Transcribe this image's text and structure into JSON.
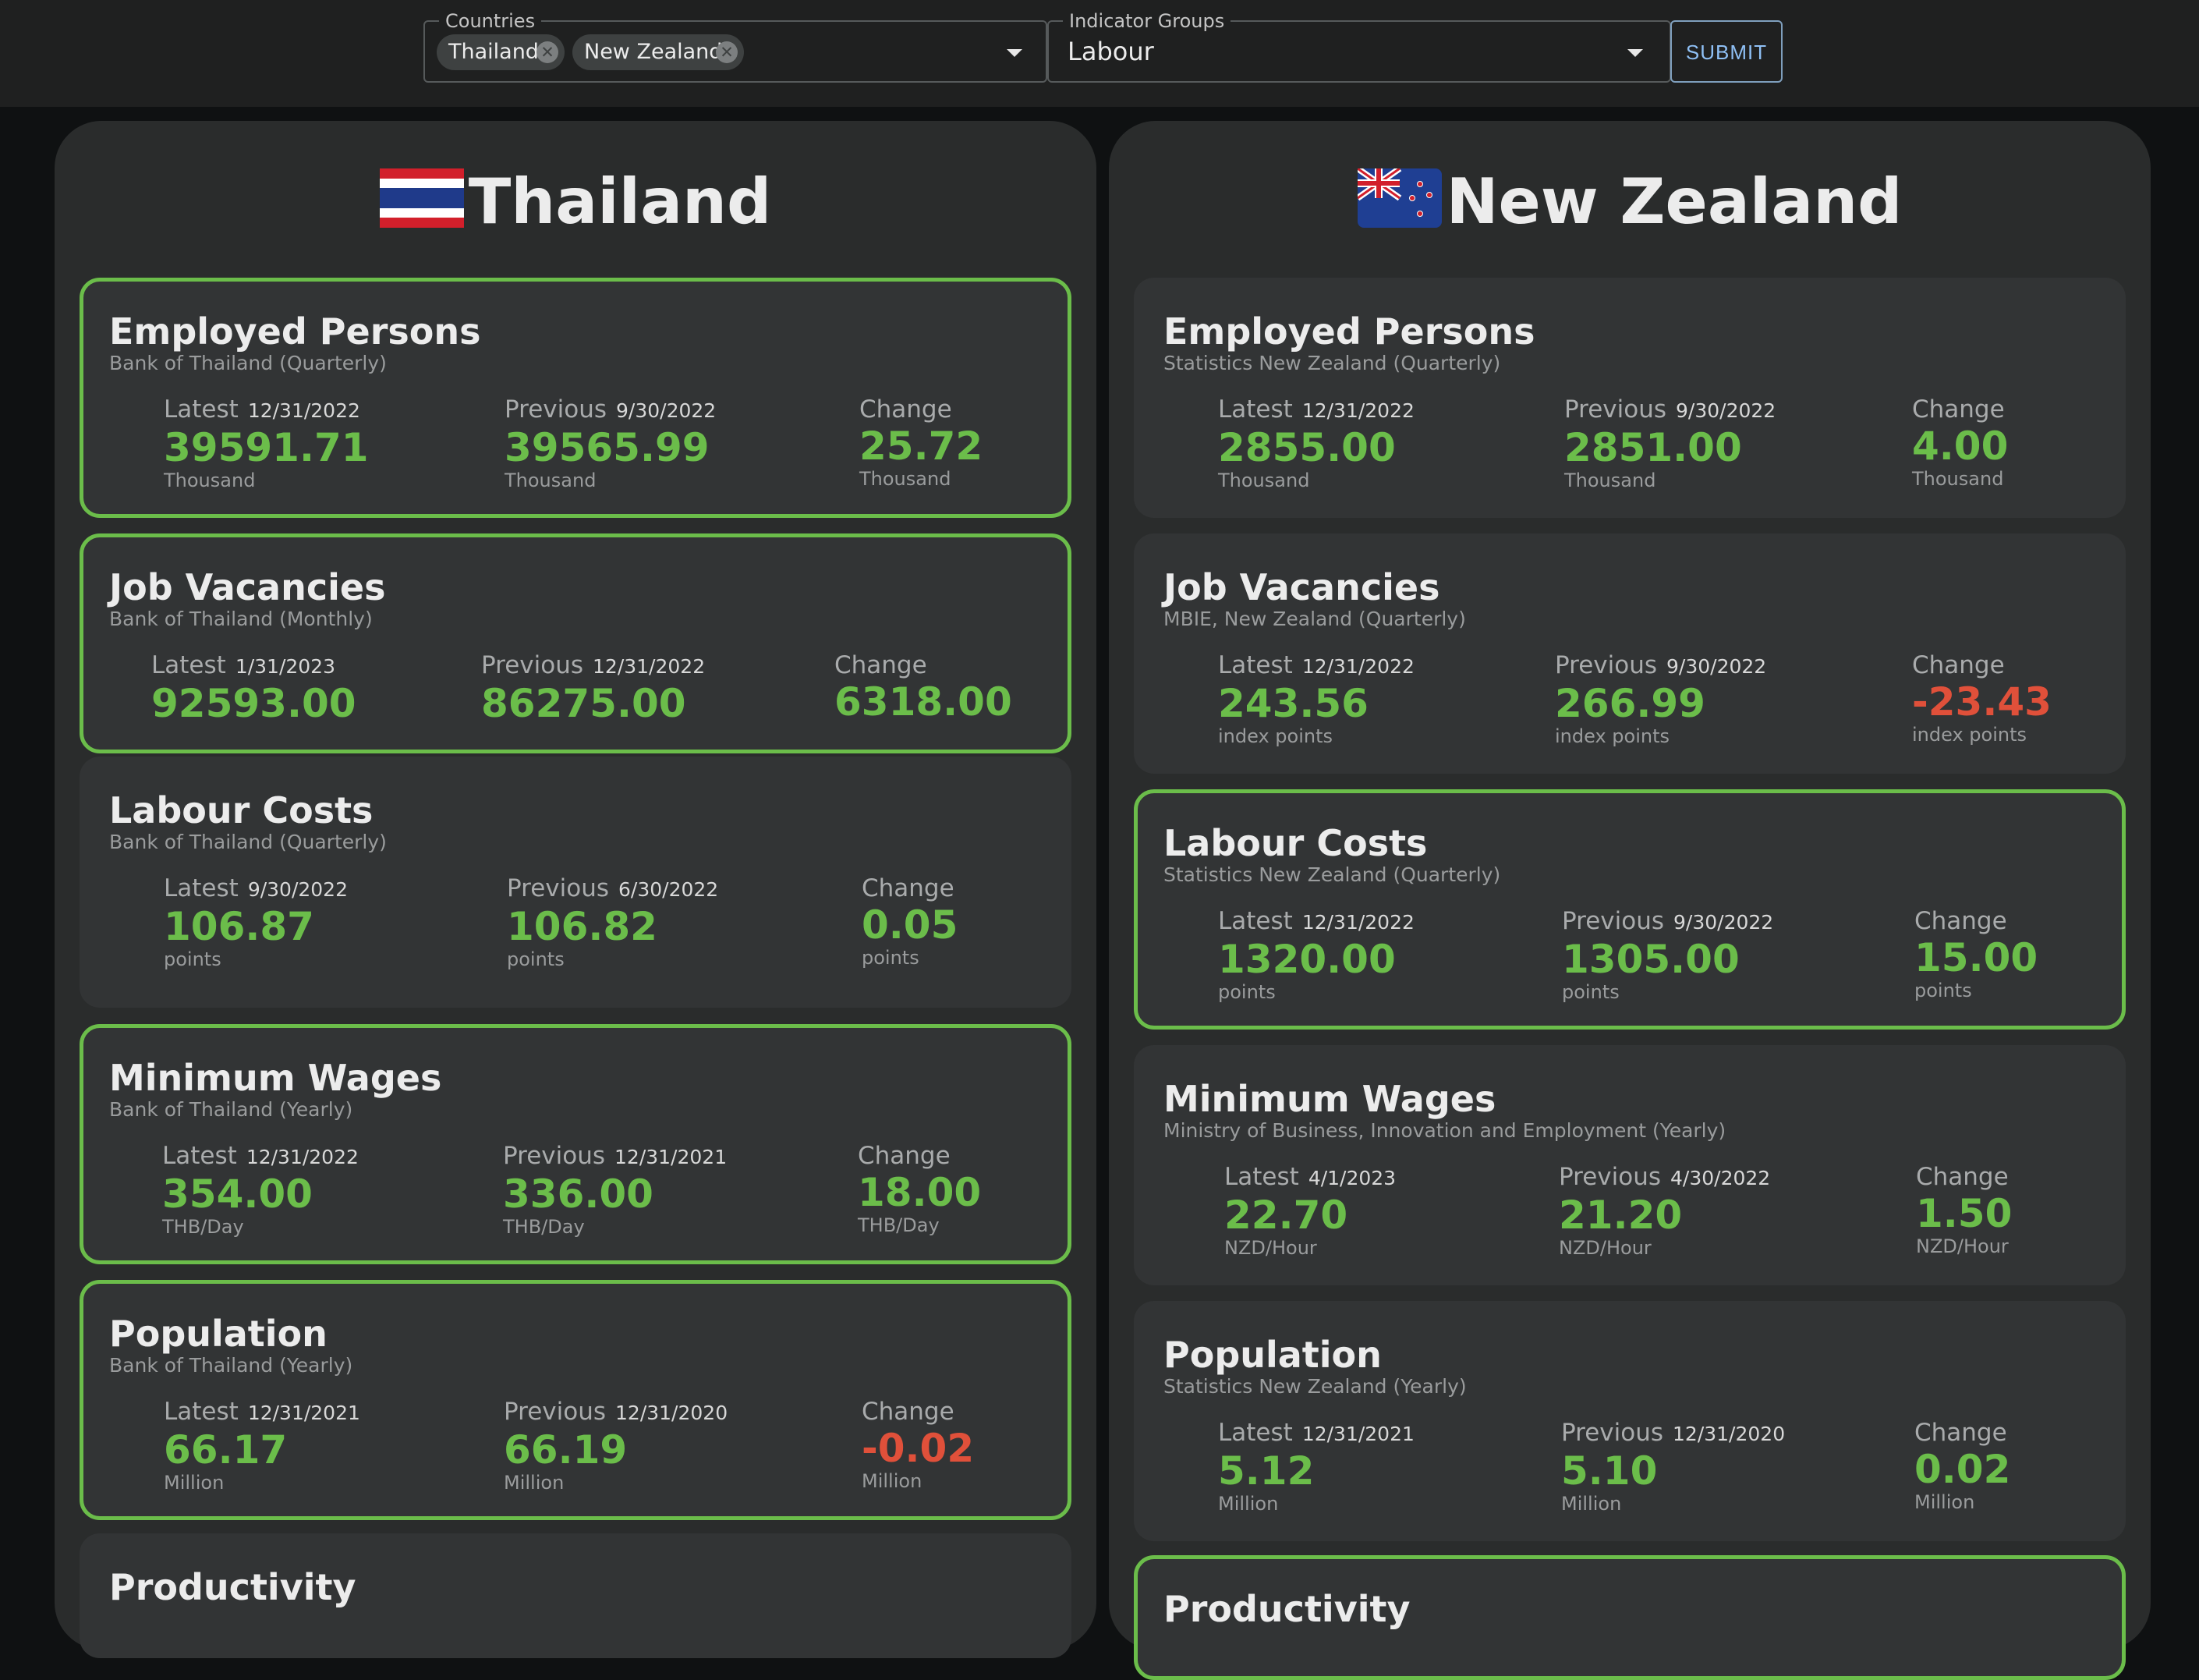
{
  "filters": {
    "countries_label": "Countries",
    "countries": [
      "Thailand",
      "New Zealand"
    ],
    "indicator_groups_label": "Indicator Groups",
    "indicator_group_value": "Labour",
    "submit_label": "SUBMIT"
  },
  "colors": {
    "positive": "#6bbd4a",
    "negative": "#e0503a",
    "highlight_border": "#6bbd4a"
  },
  "panels": [
    {
      "country": "Thailand",
      "flag_icon": "thailand-flag-icon",
      "indicators": [
        {
          "name": "Employed Persons",
          "source": "Bank of Thailand (Quarterly)",
          "highlighted": true,
          "latest_label": "Latest",
          "latest_date": "12/31/2022",
          "latest_value": "39591.71",
          "previous_label": "Previous",
          "previous_date": "9/30/2022",
          "previous_value": "39565.99",
          "change_label": "Change",
          "change_value": "25.72",
          "unit": "Thousand"
        },
        {
          "name": "Job Vacancies",
          "source": "Bank of Thailand (Monthly)",
          "highlighted": true,
          "latest_label": "Latest",
          "latest_date": "1/31/2023",
          "latest_value": "92593.00",
          "previous_label": "Previous",
          "previous_date": "12/31/2022",
          "previous_value": "86275.00",
          "change_label": "Change",
          "change_value": "6318.00",
          "unit": ""
        },
        {
          "name": "Labour Costs",
          "source": "Bank of Thailand (Quarterly)",
          "highlighted": false,
          "latest_label": "Latest",
          "latest_date": "9/30/2022",
          "latest_value": "106.87",
          "previous_label": "Previous",
          "previous_date": "6/30/2022",
          "previous_value": "106.82",
          "change_label": "Change",
          "change_value": "0.05",
          "unit": "points"
        },
        {
          "name": "Minimum Wages",
          "source": "Bank of Thailand (Yearly)",
          "highlighted": true,
          "latest_label": "Latest",
          "latest_date": "12/31/2022",
          "latest_value": "354.00",
          "previous_label": "Previous",
          "previous_date": "12/31/2021",
          "previous_value": "336.00",
          "change_label": "Change",
          "change_value": "18.00",
          "unit": "THB/Day"
        },
        {
          "name": "Population",
          "source": "Bank of Thailand (Yearly)",
          "highlighted": true,
          "latest_label": "Latest",
          "latest_date": "12/31/2021",
          "latest_value": "66.17",
          "previous_label": "Previous",
          "previous_date": "12/31/2020",
          "previous_value": "66.19",
          "change_label": "Change",
          "change_value": "-0.02",
          "unit": "Million"
        },
        {
          "name": "Productivity",
          "source": "",
          "highlighted": false,
          "latest_label": "",
          "latest_date": "",
          "latest_value": "",
          "previous_label": "",
          "previous_date": "",
          "previous_value": "",
          "change_label": "",
          "change_value": "",
          "unit": ""
        }
      ]
    },
    {
      "country": "New Zealand",
      "flag_icon": "new-zealand-flag-icon",
      "indicators": [
        {
          "name": "Employed Persons",
          "source": "Statistics New Zealand (Quarterly)",
          "highlighted": false,
          "latest_label": "Latest",
          "latest_date": "12/31/2022",
          "latest_value": "2855.00",
          "previous_label": "Previous",
          "previous_date": "9/30/2022",
          "previous_value": "2851.00",
          "change_label": "Change",
          "change_value": "4.00",
          "unit": "Thousand"
        },
        {
          "name": "Job Vacancies",
          "source": "MBIE, New Zealand (Quarterly)",
          "highlighted": false,
          "latest_label": "Latest",
          "latest_date": "12/31/2022",
          "latest_value": "243.56",
          "previous_label": "Previous",
          "previous_date": "9/30/2022",
          "previous_value": "266.99",
          "change_label": "Change",
          "change_value": "-23.43",
          "unit": "index points"
        },
        {
          "name": "Labour Costs",
          "source": "Statistics New Zealand (Quarterly)",
          "highlighted": true,
          "latest_label": "Latest",
          "latest_date": "12/31/2022",
          "latest_value": "1320.00",
          "previous_label": "Previous",
          "previous_date": "9/30/2022",
          "previous_value": "1305.00",
          "change_label": "Change",
          "change_value": "15.00",
          "unit": "points"
        },
        {
          "name": "Minimum Wages",
          "source": "Ministry of Business, Innovation and Employment (Yearly)",
          "highlighted": false,
          "latest_label": "Latest",
          "latest_date": "4/1/2023",
          "latest_value": "22.70",
          "previous_label": "Previous",
          "previous_date": "4/30/2022",
          "previous_value": "21.20",
          "change_label": "Change",
          "change_value": "1.50",
          "unit": "NZD/Hour"
        },
        {
          "name": "Population",
          "source": "Statistics New Zealand (Yearly)",
          "highlighted": false,
          "latest_label": "Latest",
          "latest_date": "12/31/2021",
          "latest_value": "5.12",
          "previous_label": "Previous",
          "previous_date": "12/31/2020",
          "previous_value": "5.10",
          "change_label": "Change",
          "change_value": "0.02",
          "unit": "Million"
        },
        {
          "name": "Productivity",
          "source": "",
          "highlighted": true,
          "latest_label": "",
          "latest_date": "",
          "latest_value": "",
          "previous_label": "",
          "previous_date": "",
          "previous_value": "",
          "change_label": "",
          "change_value": "",
          "unit": ""
        }
      ]
    }
  ]
}
